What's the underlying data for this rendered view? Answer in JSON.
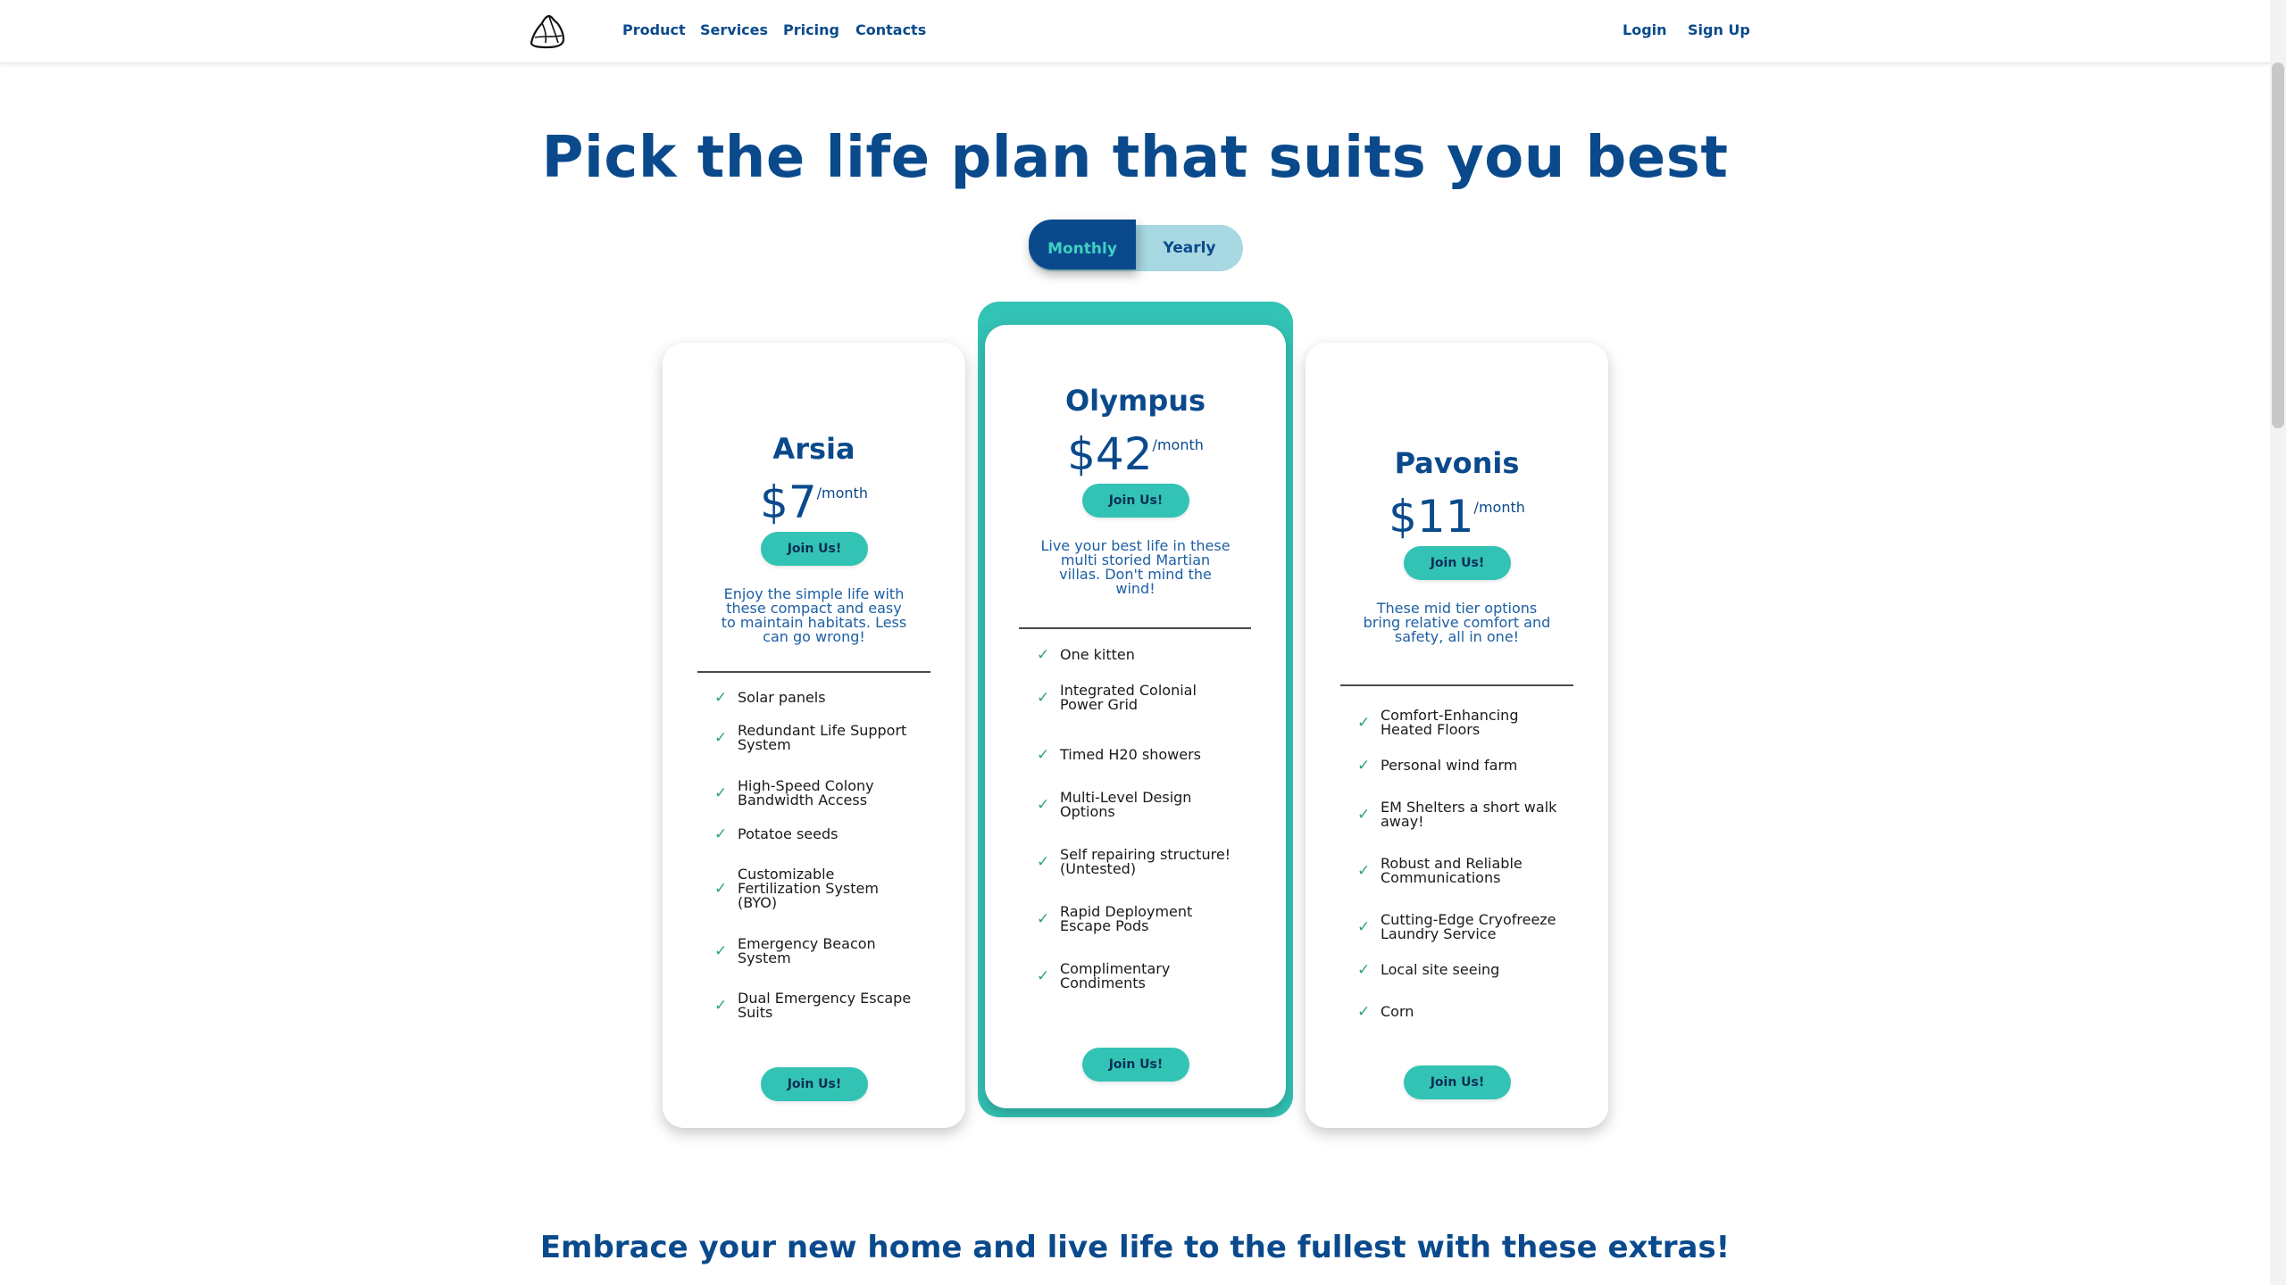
{
  "nav": {
    "logo_icon": "mountain-logo-icon",
    "links": [
      "Product",
      "Services",
      "Pricing",
      "Contacts"
    ],
    "login": "Login",
    "signup": "Sign Up"
  },
  "hero": {
    "title": "Pick the life plan that suits you best"
  },
  "billing_toggle": {
    "monthly": "Monthly",
    "yearly": "Yearly",
    "selected": "Monthly"
  },
  "colors": {
    "brand": "#0a4a8c",
    "accent": "#33c3b5",
    "check": "#2aa37a"
  },
  "plans": [
    {
      "name": "Arsia",
      "price": "$7",
      "period": "/month",
      "cta": "Join Us!",
      "description": [
        "Enjoy the simple life with",
        "these compact and easy",
        "to maintain habitats. Less",
        "can go wrong!"
      ],
      "features": [
        [
          "Solar panels"
        ],
        [
          "Redundant Life Support",
          "System"
        ],
        [
          "High-Speed Colony",
          "Bandwidth Access"
        ],
        [
          "Potatoe seeds"
        ],
        [
          "Customizable",
          "Fertilization System",
          "(BYO)"
        ],
        [
          "Emergency Beacon",
          "System"
        ],
        [
          "Dual Emergency Escape",
          "Suits"
        ]
      ],
      "cta_bottom": "Join Us!"
    },
    {
      "name": "Olympus",
      "price": "$42",
      "period": "/month",
      "cta": "Join Us!",
      "description": [
        "Live your best life in these",
        "multi storied Martian",
        "villas. Don't mind the",
        "wind!"
      ],
      "features": [
        [
          "One kitten"
        ],
        [
          "Integrated Colonial",
          "Power Grid"
        ],
        [
          "Timed H20 showers"
        ],
        [
          "Multi-Level Design",
          "Options"
        ],
        [
          "Self repairing structure!",
          "(Untested)"
        ],
        [
          "Rapid Deployment",
          "Escape Pods"
        ],
        [
          "Complimentary",
          "Condiments"
        ]
      ],
      "cta_bottom": "Join Us!"
    },
    {
      "name": "Pavonis",
      "price": "$11",
      "period": "/month",
      "cta": "Join Us!",
      "description": [
        "These mid tier options",
        "bring relative comfort and",
        "safety, all in one!"
      ],
      "features": [
        [
          "Comfort-Enhancing",
          "Heated Floors"
        ],
        [
          "Personal wind farm"
        ],
        [
          "EM Shelters a short walk",
          "away!"
        ],
        [
          "Robust and Reliable",
          "Communications"
        ],
        [
          "Cutting-Edge Cryofreeze",
          "Laundry Service"
        ],
        [
          "Local site seeing"
        ],
        [
          "Corn"
        ]
      ],
      "cta_bottom": "Join Us!"
    }
  ],
  "extras": {
    "title": "Embrace your new home and live life to the fullest with these extras!"
  }
}
